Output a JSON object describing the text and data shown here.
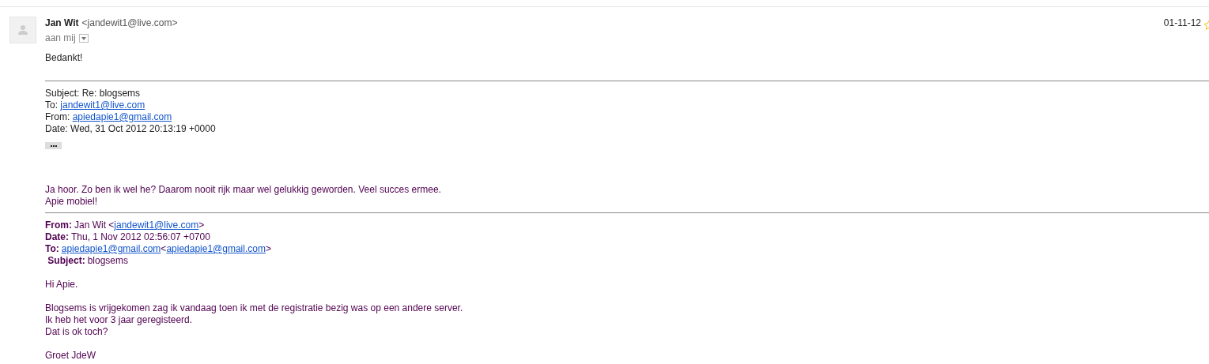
{
  "message": {
    "sender_name": "Jan Wit",
    "sender_email": "<jandewit1@live.com>",
    "recipient": "aan mij",
    "date": "01-11-12",
    "starred": false,
    "greeting": "Bedankt!",
    "forwarded_header": [
      [
        {
          "kind": "plain",
          "text": "Subject: Re: blogsems"
        }
      ],
      [
        {
          "kind": "plain",
          "text": "To: "
        },
        {
          "kind": "link",
          "text": "jandewit1@live.com"
        }
      ],
      [
        {
          "kind": "plain",
          "text": "From: "
        },
        {
          "kind": "link",
          "text": "apiedapie1@gmail.com"
        }
      ],
      [
        {
          "kind": "plain",
          "text": "Date: Wed, 31 Oct 2012 20:13:19 +0000"
        }
      ]
    ],
    "quoted_body": [
      "Ja hoor. Zo ben ik wel he? Daarom nooit rijk maar wel gelukkig geworden. Veel succes ermee.",
      "Apie mobiel!"
    ],
    "quoted_header": [
      [
        {
          "kind": "bold",
          "text": "From:"
        },
        {
          "kind": "plain",
          "text": "Jan Wit <"
        },
        {
          "kind": "link",
          "text": "jandewit1@live.com"
        },
        {
          "kind": "plain",
          "text": ">"
        }
      ],
      [
        {
          "kind": "bold",
          "text": "Date:"
        },
        {
          "kind": "plain",
          "text": "Thu, 1 Nov 2012 02:56:07 +0700"
        }
      ],
      [
        {
          "kind": "bold",
          "text": "To:"
        },
        {
          "kind": "link",
          "text": "apiedapie1@gmail.com"
        },
        {
          "kind": "plain",
          "text": "<"
        },
        {
          "kind": "link",
          "text": "apiedapie1@gmail.com"
        },
        {
          "kind": "plain",
          "text": ">"
        }
      ],
      [
        {
          "kind": "bold",
          "text": " Subject:"
        },
        {
          "kind": "plain",
          "text": "blogsems"
        }
      ]
    ],
    "quoted_paragraphs": [
      [
        "Hi Apie."
      ],
      [
        "Blogsems is vrijgekomen zag ik vandaag toen ik met de registratie bezig was op een andere server.",
        "Ik heb het voor 3 jaar geregisteerd.",
        "Dat is ok toch?"
      ],
      [
        "Groet JdeW"
      ]
    ]
  }
}
